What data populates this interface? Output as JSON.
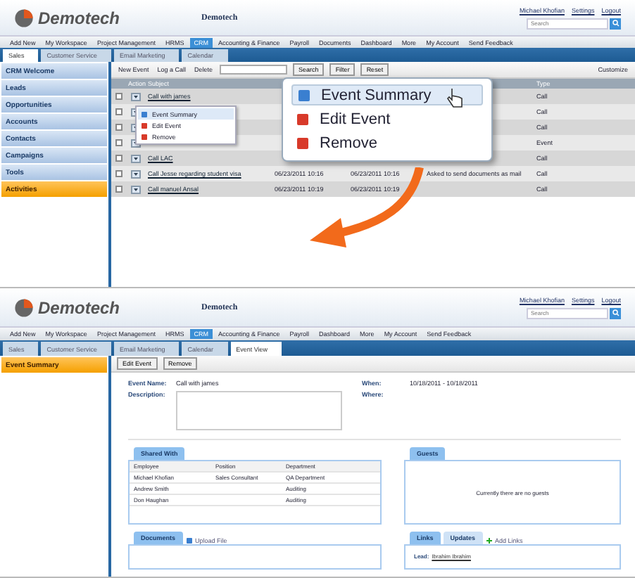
{
  "screens": [
    {
      "kind": "list",
      "header": {
        "brand": "Demotech",
        "title": "Demotech",
        "user": "Michael Khofian",
        "links": [
          "Settings",
          "Logout"
        ],
        "search_placeholder": "Search"
      },
      "menu": [
        {
          "label": "Add New",
          "selected": false
        },
        {
          "label": "My Workspace",
          "selected": false
        },
        {
          "label": "Project Management",
          "selected": false
        },
        {
          "label": "HRMS",
          "selected": false
        },
        {
          "label": "CRM",
          "selected": true
        },
        {
          "label": "Accounting & Finance",
          "selected": false
        },
        {
          "label": "Payroll",
          "selected": false
        },
        {
          "label": "Documents",
          "selected": false
        },
        {
          "label": "Dashboard",
          "selected": false
        },
        {
          "label": "More",
          "selected": false
        },
        {
          "label": "My Account",
          "selected": false
        },
        {
          "label": "Send Feedback",
          "selected": false
        }
      ],
      "tabs": [
        {
          "label": "Sales",
          "selected": true
        },
        {
          "label": "Customer Service",
          "selected": false
        },
        {
          "label": "Email Marketing",
          "selected": false
        },
        {
          "label": "Calendar",
          "selected": false
        }
      ],
      "sidebar": [
        {
          "label": "CRM Welcome",
          "selected": false
        },
        {
          "label": "Leads",
          "selected": false
        },
        {
          "label": "Opportunities",
          "selected": false
        },
        {
          "label": "Accounts",
          "selected": false
        },
        {
          "label": "Contacts",
          "selected": false
        },
        {
          "label": "Campaigns",
          "selected": false
        },
        {
          "label": "Tools",
          "selected": false
        },
        {
          "label": "Activities",
          "selected": true
        }
      ],
      "toolbar": {
        "buttons": [
          "New Event",
          "Log a Call",
          "Delete"
        ],
        "actions": [
          "Search",
          "Filter",
          "Reset"
        ],
        "customize": "Customize"
      },
      "table": {
        "columns": [
          "Action",
          "Subject",
          "Type"
        ],
        "rows": [
          {
            "checked": false,
            "subject": "Call with james",
            "date_1": "",
            "date_2": "",
            "note": "",
            "type": "Call"
          },
          {
            "checked": false,
            "subject": "",
            "date_1": "",
            "date_2": "",
            "note": "",
            "type": "Call"
          },
          {
            "checked": false,
            "subject": "",
            "date_1": "",
            "date_2": "",
            "note": "",
            "type": "Call"
          },
          {
            "checked": false,
            "subject": "",
            "date_1": "",
            "date_2": "",
            "note": "",
            "type": "Event"
          },
          {
            "checked": false,
            "subject": "Call LAC",
            "date_1": "",
            "date_2": "",
            "note": "",
            "type": "Call"
          },
          {
            "checked": false,
            "subject": "Call Jesse regarding student visa",
            "date_1": "06/23/2011 10:16",
            "date_2": "06/23/2011 10:16",
            "note": "Asked to send documents as mail",
            "type": "Call"
          },
          {
            "checked": false,
            "subject": "Call manuel Ansal",
            "date_1": "06/23/2011 10:19",
            "date_2": "06/23/2011 10:19",
            "note": "",
            "type": "Call"
          }
        ]
      },
      "row_menu": [
        {
          "label": "Event Summary",
          "selected": true
        },
        {
          "label": "Edit Event",
          "selected": false
        },
        {
          "label": "Remove",
          "selected": false
        }
      ],
      "callout": [
        {
          "label": "Event Summary",
          "selected": true
        },
        {
          "label": "Edit Event",
          "selected": false
        },
        {
          "label": "Remove",
          "selected": false
        }
      ]
    },
    {
      "kind": "detail",
      "header": {
        "brand": "Demotech",
        "title": "Demotech",
        "user": "Michael Khofian",
        "links": [
          "Settings",
          "Logout"
        ],
        "search_placeholder": "Search"
      },
      "menu": [
        {
          "label": "Add New",
          "selected": false
        },
        {
          "label": "My Workspace",
          "selected": false
        },
        {
          "label": "Project Management",
          "selected": false
        },
        {
          "label": "HRMS",
          "selected": false
        },
        {
          "label": "CRM",
          "selected": true
        },
        {
          "label": "Accounting & Finance",
          "selected": false
        },
        {
          "label": "Payroll",
          "selected": false
        },
        {
          "label": "Dashboard",
          "selected": false
        },
        {
          "label": "More",
          "selected": false
        },
        {
          "label": "My Account",
          "selected": false
        },
        {
          "label": "Send Feedback",
          "selected": false
        }
      ],
      "tabs": [
        {
          "label": "Sales",
          "selected": false
        },
        {
          "label": "Customer Service",
          "selected": false
        },
        {
          "label": "Email Marketing",
          "selected": false
        },
        {
          "label": "Calendar",
          "selected": false
        },
        {
          "label": "Event View",
          "selected": true
        }
      ],
      "sidebar": [
        {
          "label": "Event Summary",
          "selected": true
        }
      ],
      "toolbar": {
        "buttons": [
          "Edit Event",
          "Remove"
        ]
      },
      "form": {
        "event_name_label": "Event Name:",
        "event_name": "Call with james",
        "description_label": "Description:",
        "when_label": "When:",
        "when": "10/18/2011 - 10/18/2011",
        "where_label": "Where:"
      },
      "shared_with": {
        "title": "Shared With",
        "columns": [
          "Employee",
          "Position",
          "Department"
        ],
        "rows": [
          [
            "Michael Khofian",
            "Sales Consultant",
            "QA Department"
          ],
          [
            "Andrew Smith",
            "",
            "Auditing"
          ],
          [
            "Don Haughan",
            "",
            "Auditing"
          ]
        ]
      },
      "guests": {
        "title": "Guests",
        "empty": "Currently there are no guests"
      },
      "documents": {
        "title": "Documents",
        "upload": "Upload File"
      },
      "links": {
        "tabs": [
          {
            "label": "Links",
            "selected": true
          },
          {
            "label": "Updates",
            "selected": false
          }
        ],
        "add": "Add Links",
        "lead_label": "Lead:",
        "lead": "Ibrahim Ibrahim"
      }
    }
  ]
}
